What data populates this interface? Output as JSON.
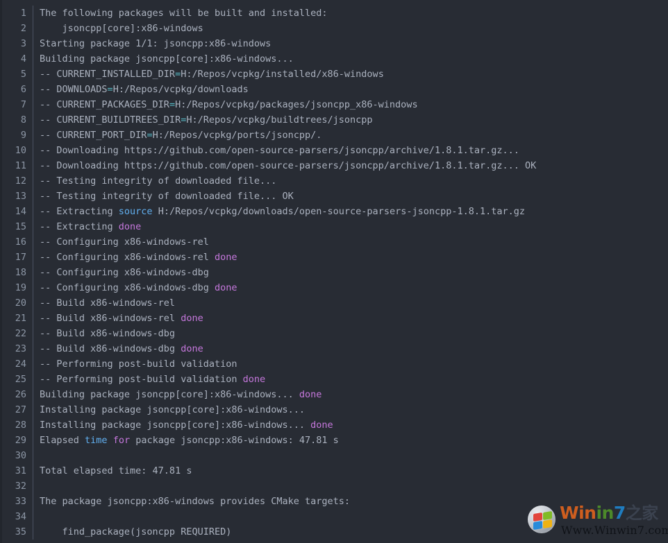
{
  "terminal": {
    "background_color": "#282c34",
    "text_color": "#abb2bf",
    "gutter_color": "#8d97a6",
    "accent_operator": "#56b6c2",
    "accent_keyword": "#c678dd",
    "accent_function": "#61afef",
    "first_line_number": 1,
    "total_lines": 35
  },
  "lines": [
    {
      "n": "1",
      "segments": [
        {
          "t": "The following packages will be built and installed:",
          "c": "plain"
        }
      ]
    },
    {
      "n": "2",
      "segments": [
        {
          "t": "    jsoncpp[core]:x86-windows",
          "c": "plain"
        }
      ]
    },
    {
      "n": "3",
      "segments": [
        {
          "t": "Starting package 1/1: jsoncpp:x86-windows",
          "c": "plain"
        }
      ]
    },
    {
      "n": "4",
      "segments": [
        {
          "t": "Building package jsoncpp[core]:x86-windows...",
          "c": "plain"
        }
      ]
    },
    {
      "n": "5",
      "segments": [
        {
          "t": "-- CURRENT_INSTALLED_DIR",
          "c": "plain"
        },
        {
          "t": "=",
          "c": "op"
        },
        {
          "t": "H:/Repos/vcpkg/installed/x86-windows",
          "c": "plain"
        }
      ]
    },
    {
      "n": "6",
      "segments": [
        {
          "t": "-- DOWNLOADS",
          "c": "plain"
        },
        {
          "t": "=",
          "c": "op"
        },
        {
          "t": "H:/Repos/vcpkg/downloads",
          "c": "plain"
        }
      ]
    },
    {
      "n": "7",
      "segments": [
        {
          "t": "-- CURRENT_PACKAGES_DIR",
          "c": "plain"
        },
        {
          "t": "=",
          "c": "op"
        },
        {
          "t": "H:/Repos/vcpkg/packages/jsoncpp_x86-windows",
          "c": "plain"
        }
      ]
    },
    {
      "n": "8",
      "segments": [
        {
          "t": "-- CURRENT_BUILDTREES_DIR",
          "c": "plain"
        },
        {
          "t": "=",
          "c": "op"
        },
        {
          "t": "H:/Repos/vcpkg/buildtrees/jsoncpp",
          "c": "plain"
        }
      ]
    },
    {
      "n": "9",
      "segments": [
        {
          "t": "-- CURRENT_PORT_DIR",
          "c": "plain"
        },
        {
          "t": "=",
          "c": "op"
        },
        {
          "t": "H:/Repos/vcpkg/ports/jsoncpp/.",
          "c": "plain"
        }
      ]
    },
    {
      "n": "10",
      "segments": [
        {
          "t": "-- Downloading https://github.com/open-source-parsers/jsoncpp/archive/1.8.1.tar.gz...",
          "c": "plain"
        }
      ]
    },
    {
      "n": "11",
      "segments": [
        {
          "t": "-- Downloading https://github.com/open-source-parsers/jsoncpp/archive/1.8.1.tar.gz... OK",
          "c": "plain"
        }
      ]
    },
    {
      "n": "12",
      "segments": [
        {
          "t": "-- Testing integrity of downloaded file...",
          "c": "plain"
        }
      ]
    },
    {
      "n": "13",
      "segments": [
        {
          "t": "-- Testing integrity of downloaded file... OK",
          "c": "plain"
        }
      ]
    },
    {
      "n": "14",
      "segments": [
        {
          "t": "-- Extracting ",
          "c": "plain"
        },
        {
          "t": "source",
          "c": "fn"
        },
        {
          "t": " H:/Repos/vcpkg/downloads/open-source-parsers-jsoncpp-1.8.1.tar.gz",
          "c": "plain"
        }
      ]
    },
    {
      "n": "15",
      "segments": [
        {
          "t": "-- Extracting ",
          "c": "plain"
        },
        {
          "t": "done",
          "c": "kw"
        }
      ]
    },
    {
      "n": "16",
      "segments": [
        {
          "t": "-- Configuring x86-windows-rel",
          "c": "plain"
        }
      ]
    },
    {
      "n": "17",
      "segments": [
        {
          "t": "-- Configuring x86-windows-rel ",
          "c": "plain"
        },
        {
          "t": "done",
          "c": "kw"
        }
      ]
    },
    {
      "n": "18",
      "segments": [
        {
          "t": "-- Configuring x86-windows-dbg",
          "c": "plain"
        }
      ]
    },
    {
      "n": "19",
      "segments": [
        {
          "t": "-- Configuring x86-windows-dbg ",
          "c": "plain"
        },
        {
          "t": "done",
          "c": "kw"
        }
      ]
    },
    {
      "n": "20",
      "segments": [
        {
          "t": "-- Build x86-windows-rel",
          "c": "plain"
        }
      ]
    },
    {
      "n": "21",
      "segments": [
        {
          "t": "-- Build x86-windows-rel ",
          "c": "plain"
        },
        {
          "t": "done",
          "c": "kw"
        }
      ]
    },
    {
      "n": "22",
      "segments": [
        {
          "t": "-- Build x86-windows-dbg",
          "c": "plain"
        }
      ]
    },
    {
      "n": "23",
      "segments": [
        {
          "t": "-- Build x86-windows-dbg ",
          "c": "plain"
        },
        {
          "t": "done",
          "c": "kw"
        }
      ]
    },
    {
      "n": "24",
      "segments": [
        {
          "t": "-- Performing post-build validation",
          "c": "plain"
        }
      ]
    },
    {
      "n": "25",
      "segments": [
        {
          "t": "-- Performing post-build validation ",
          "c": "plain"
        },
        {
          "t": "done",
          "c": "kw"
        }
      ]
    },
    {
      "n": "26",
      "segments": [
        {
          "t": "Building package jsoncpp[core]:x86-windows... ",
          "c": "plain"
        },
        {
          "t": "done",
          "c": "kw"
        }
      ]
    },
    {
      "n": "27",
      "segments": [
        {
          "t": "Installing package jsoncpp[core]:x86-windows...",
          "c": "plain"
        }
      ]
    },
    {
      "n": "28",
      "segments": [
        {
          "t": "Installing package jsoncpp[core]:x86-windows... ",
          "c": "plain"
        },
        {
          "t": "done",
          "c": "kw"
        }
      ]
    },
    {
      "n": "29",
      "segments": [
        {
          "t": "Elapsed ",
          "c": "plain"
        },
        {
          "t": "time",
          "c": "fn"
        },
        {
          "t": " ",
          "c": "plain"
        },
        {
          "t": "for",
          "c": "kw"
        },
        {
          "t": " package jsoncpp:x86-windows: 47.81 s",
          "c": "plain"
        }
      ]
    },
    {
      "n": "30",
      "segments": [
        {
          "t": "",
          "c": "plain"
        }
      ]
    },
    {
      "n": "31",
      "segments": [
        {
          "t": "Total elapsed time: 47.81 s",
          "c": "plain"
        }
      ]
    },
    {
      "n": "32",
      "segments": [
        {
          "t": "",
          "c": "plain"
        }
      ]
    },
    {
      "n": "33",
      "segments": [
        {
          "t": "The package jsoncpp:x86-windows provides CMake targets:",
          "c": "plain"
        }
      ]
    },
    {
      "n": "34",
      "segments": [
        {
          "t": "",
          "c": "plain"
        }
      ]
    },
    {
      "n": "35",
      "segments": [
        {
          "t": "    find_package(jsoncpp REQUIRED)",
          "c": "plain"
        }
      ]
    }
  ],
  "watermark": {
    "brand_win": "Win",
    "brand_i": "i",
    "brand_n": "n",
    "brand_seven": "7",
    "brand_cn": "之家",
    "url": "Www.Winwin7.com",
    "logo_name": "windows-logo"
  }
}
